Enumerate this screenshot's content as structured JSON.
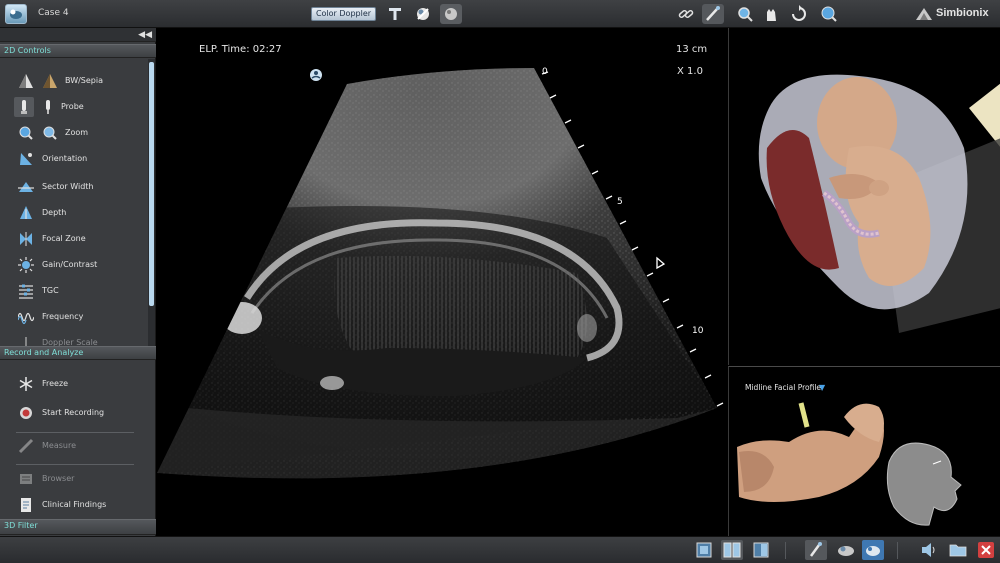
{
  "topbar": {
    "case_label": "Case 4",
    "color_doppler_label": "Color Doppler",
    "brand": "Simbionix",
    "icons": [
      "app-logo",
      "probe-tool-icon",
      "fetus-view-icon",
      "fetus-heart-icon",
      "link-icon",
      "probe-pen-icon",
      "magnify-icon",
      "hand-pan-icon",
      "rotate-icon",
      "zoom-icon"
    ]
  },
  "left_panel": {
    "section_2d": "2D Controls",
    "controls": [
      {
        "label": "BW/Sepia",
        "icon": "bw-sepia-icon"
      },
      {
        "label": "Probe",
        "icon": "probe-icon"
      },
      {
        "label": "Zoom",
        "icon": "zoom-icon"
      },
      {
        "label": "Orientation",
        "icon": "orientation-icon"
      },
      {
        "label": "Sector Width",
        "icon": "sector-width-icon"
      },
      {
        "label": "Depth",
        "icon": "depth-icon"
      },
      {
        "label": "Focal Zone",
        "icon": "focal-zone-icon"
      },
      {
        "label": "Gain/Contrast",
        "icon": "gain-contrast-icon"
      },
      {
        "label": "TGC",
        "icon": "tgc-icon"
      },
      {
        "label": "Frequency",
        "icon": "frequency-icon"
      },
      {
        "label": "Doppler Scale",
        "icon": "doppler-scale-icon"
      }
    ],
    "section_record": "Record and Analyze",
    "record_items": [
      {
        "label": "Freeze",
        "icon": "freeze-icon",
        "enabled": true
      },
      {
        "label": "Start Recording",
        "icon": "record-icon",
        "enabled": true
      },
      {
        "label": "Measure",
        "icon": "measure-icon",
        "enabled": false
      },
      {
        "label": "Browser",
        "icon": "browser-icon",
        "enabled": false
      },
      {
        "label": "Clinical Findings",
        "icon": "clinical-findings-icon",
        "enabled": true
      }
    ],
    "section_3d": "3D Filter",
    "collapse_glyph": "◀◀"
  },
  "ultrasound": {
    "elp_time": "ELP. Time: 02:27",
    "depth": "13 cm",
    "zoom": "X 1.0",
    "scale_labels": [
      "0",
      "5",
      "10"
    ]
  },
  "profile_view": {
    "label": "Midline Facial Profile"
  },
  "bottombar": {
    "icons": [
      "single-view-icon",
      "dual-view-icon",
      "triple-view-icon",
      "probe-cart-icon",
      "fetus-model-icon",
      "fetus-model-alt-icon",
      "volume-icon",
      "folder-icon",
      "close-icon"
    ]
  },
  "colors": {
    "accent_header": "#7fe0d8",
    "panel_bg": "#3a3c3f",
    "scroll_thumb": "#b9d8ee",
    "close_red": "#d24040"
  }
}
